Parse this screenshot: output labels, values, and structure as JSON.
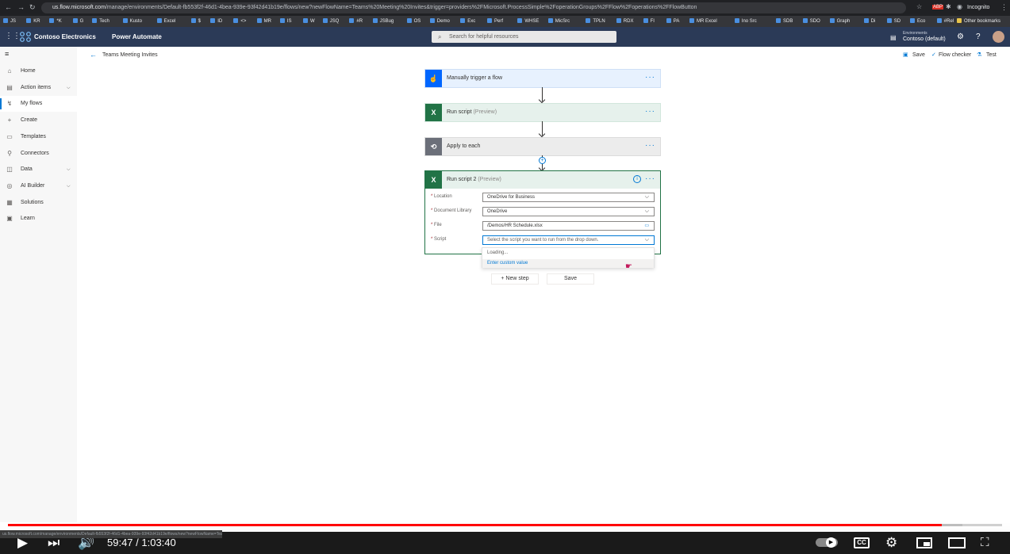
{
  "browser": {
    "url_host": "us.flow.microsoft.com",
    "url_path": "/manage/environments/Default-fb553f2f-46d1-4bea-939e-93f42d41b19e/flows/new?newFlowName=Teams%20Meeting%20Invites&trigger=providers%2FMicrosoft.ProcessSimple%2FoperationGroups%2FFlow%2Foperations%2FFlowButton",
    "profile": "Incognito",
    "bookmarks": [
      "JS",
      "KR",
      "*K",
      "G",
      "Tech",
      "Kusto",
      "Excel",
      "$",
      "ID",
      "<>",
      "MR",
      "IS",
      "W",
      "JSQ",
      "#R",
      "JSBug",
      "OS",
      "Demo",
      "Exc",
      "Perf",
      "WHSE",
      "MicSrc",
      "TPLN",
      "RDX",
      "FI",
      "PA",
      "MR Excel",
      "Ino Src",
      "SDB",
      "SDO",
      "Graph",
      "Di",
      "SD",
      "Eco",
      "#Rel"
    ],
    "other_bookmarks": "Other bookmarks"
  },
  "header": {
    "org": "Contoso Electronics",
    "app": "Power Automate",
    "search_placeholder": "Search for helpful resources",
    "env_label": "Environments",
    "env_value": "Contoso (default)"
  },
  "sidebar": {
    "items": [
      {
        "label": "Home",
        "icon": "home-icon",
        "glyph": "⌂"
      },
      {
        "label": "Action items",
        "icon": "clipboard-icon",
        "glyph": "▤",
        "expandable": true
      },
      {
        "label": "My flows",
        "icon": "flow-icon",
        "glyph": "↯",
        "active": true
      },
      {
        "label": "Create",
        "icon": "plus-icon",
        "glyph": "+"
      },
      {
        "label": "Templates",
        "icon": "template-icon",
        "glyph": "▭"
      },
      {
        "label": "Connectors",
        "icon": "connector-icon",
        "glyph": "⚲"
      },
      {
        "label": "Data",
        "icon": "database-icon",
        "glyph": "◫",
        "expandable": true
      },
      {
        "label": "AI Builder",
        "icon": "ai-icon",
        "glyph": "◎",
        "expandable": true
      },
      {
        "label": "Solutions",
        "icon": "solutions-icon",
        "glyph": "▦"
      },
      {
        "label": "Learn",
        "icon": "book-icon",
        "glyph": "▣"
      }
    ]
  },
  "commandbar": {
    "flow_name": "Teams Meeting Invites",
    "save": "Save",
    "checker": "Flow checker",
    "test": "Test"
  },
  "flow": {
    "trigger": "Manually trigger a flow",
    "step1_title": "Run script",
    "step1_tag": "(Preview)",
    "step2_title": "Apply to each",
    "step3_title": "Run script 2",
    "step3_tag": "(Preview)",
    "fields": [
      {
        "label": "Location",
        "value": "OneDrive for Business"
      },
      {
        "label": "Document Library",
        "value": "OneDrive"
      },
      {
        "label": "File",
        "value": "/Demos/HR Schedule.xlsx"
      },
      {
        "label": "Script",
        "value": "Select the script you want to run from the drop down."
      }
    ],
    "dropdown_loading": "Loading...",
    "dropdown_custom": "Enter custom value",
    "new_step": "+ New step",
    "save_btn": "Save"
  },
  "player": {
    "time": "59:47 / 1:03:40",
    "progress": 0.939,
    "buffered": 0.96
  },
  "colors": {
    "header_bg": "#2b3a57",
    "trigger_blue": "#0066ff",
    "excel_green": "#217346",
    "apply_grey": "#6b6f79",
    "progress_red": "#ff0000"
  }
}
